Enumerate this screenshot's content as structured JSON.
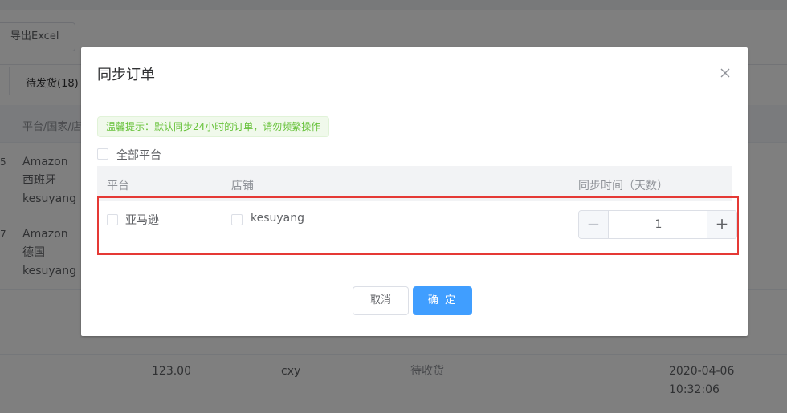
{
  "background": {
    "export_button": "导出Excel",
    "tab_pending": "待发货(18)",
    "column_platform": "平台/国家/店",
    "edge_digits": [
      "5",
      "7"
    ],
    "rows": [
      {
        "platform": "Amazon",
        "country": "西班牙",
        "shop": "kesuyang"
      },
      {
        "platform": "Amazon",
        "country": "德国",
        "shop": "kesuyang"
      }
    ],
    "bottom_row": {
      "amount": "123.00",
      "user": "cxy",
      "status": "待收货",
      "date": "2020-04-06",
      "time": "10:32:06"
    }
  },
  "dialog": {
    "title": "同步订单",
    "close_icon": "close-icon",
    "tip": "温馨提示：默认同步24小时的订单，请勿频繁操作",
    "all_platforms_label": "全部平台",
    "columns": {
      "platform": "平台",
      "shop": "店铺",
      "sync_days": "同步时间（天数）"
    },
    "row": {
      "platform": "亚马逊",
      "shop": "kesuyang",
      "sync_days": "1"
    },
    "stepper": {
      "decrease": "−",
      "increase": "+"
    },
    "buttons": {
      "cancel": "取消",
      "confirm": "确 定"
    },
    "colors": {
      "primary": "#409eff",
      "tip_text": "#67c23a",
      "highlight": "#e53935"
    }
  }
}
